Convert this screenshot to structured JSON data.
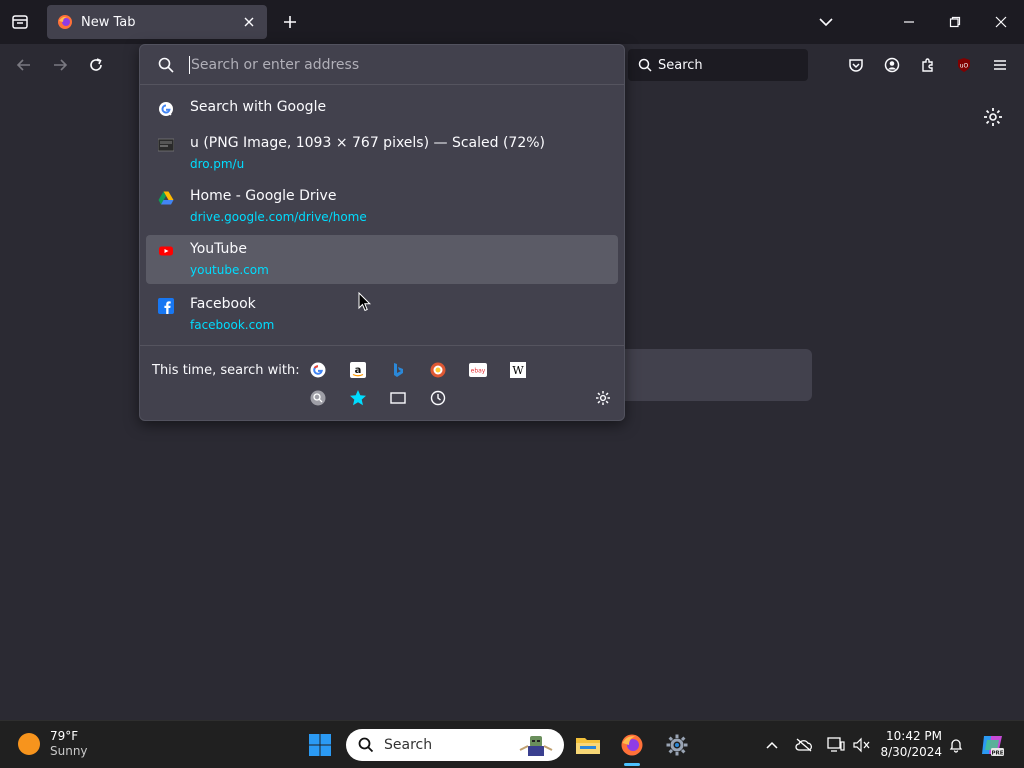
{
  "browser": {
    "tab": {
      "title": "New Tab"
    },
    "search_placeholder": "Search"
  },
  "urlbar": {
    "placeholder": "Search or enter address",
    "results": [
      {
        "icon": "google-icon",
        "title": "Search with Google",
        "url": ""
      },
      {
        "icon": "image-thumbnail-icon",
        "title": "u (PNG Image, 1093 × 767 pixels) — Scaled (72%)",
        "url": "dro.pm/u"
      },
      {
        "icon": "google-drive-icon",
        "title": "Home - Google Drive",
        "url": "drive.google.com/drive/home"
      },
      {
        "icon": "youtube-icon",
        "title": "YouTube",
        "url": "youtube.com"
      },
      {
        "icon": "facebook-icon",
        "title": "Facebook",
        "url": "facebook.com"
      }
    ],
    "oneoff_label": "This time, search with:",
    "engines": [
      "google-icon",
      "amazon-icon",
      "bing-icon",
      "duckduckgo-icon",
      "ebay-icon",
      "wikipedia-icon",
      "search-history-icon",
      "bookmarks-icon",
      "tabs-icon",
      "history-icon"
    ]
  },
  "taskbar": {
    "weather": {
      "temp": "79°F",
      "condition": "Sunny"
    },
    "search_label": "Search",
    "time": "10:42 PM",
    "date": "8/30/2024"
  },
  "colors": {
    "accent": "#00ddff",
    "panel": "#42414d",
    "toolbar": "#2b2a33",
    "tabstrip": "#1c1b22"
  }
}
